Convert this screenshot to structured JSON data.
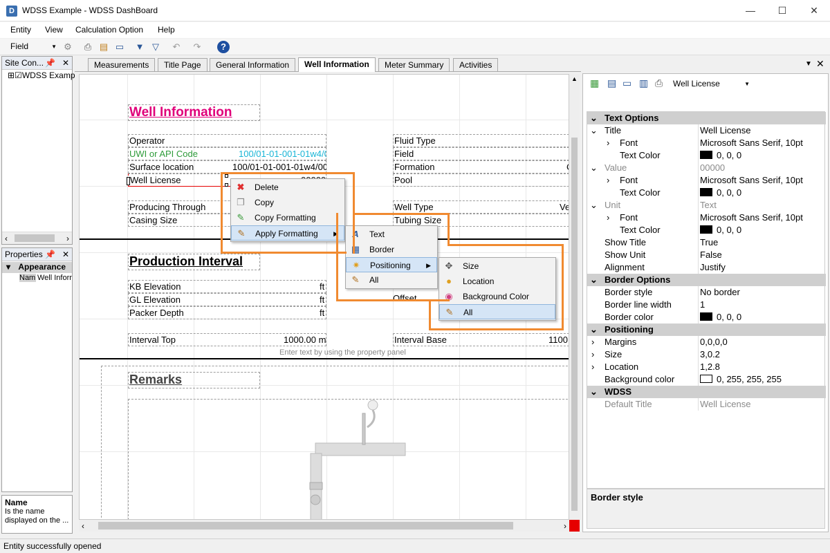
{
  "window": {
    "title": "WDSS Example - WDSS DashBoard",
    "icon_letter": "D"
  },
  "menu": [
    "Entity",
    "View",
    "Calculation Option",
    "Help"
  ],
  "toolbar": {
    "field_combo": "Field"
  },
  "site_panel": {
    "title": "Site Con...",
    "tree_item": "WDSS Examp"
  },
  "props_panel": {
    "title": "Properties",
    "section": "Appearance",
    "row_key": "Nam",
    "row_value": "Well Inform",
    "desc_title": "Name",
    "desc_text": "Is the name displayed on the ..."
  },
  "tabs": [
    "Measurements",
    "Title Page",
    "General Information",
    "Well Information",
    "Meter Summary",
    "Activities"
  ],
  "active_tab": "Well Information",
  "report": {
    "title": "Well Information",
    "left_fields": [
      {
        "label": "Operator",
        "value": ""
      },
      {
        "label": "UWI or API Code",
        "value": "100/01-01-001-01w4/0"
      },
      {
        "label": "Surface location",
        "value": "100/01-01-001-01w4/00"
      },
      {
        "label": "Well License",
        "value": "00000"
      },
      {
        "label": "Producing Through",
        "value": ""
      },
      {
        "label": "Casing Size",
        "value": ""
      }
    ],
    "right_fields": [
      "Fluid Type",
      "Field",
      "Formation",
      "Pool",
      "Well Type",
      "Tubing Size"
    ],
    "right_value_ve": "Ve",
    "right_value_c": "C",
    "production_title": "Production Interval",
    "prod_fields": [
      {
        "label": "KB Elevation",
        "unit": "ft"
      },
      {
        "label": "GL Elevation",
        "unit": "ft"
      },
      {
        "label": "Packer Depth",
        "unit": "ft"
      }
    ],
    "offset_label": "Offset",
    "interval_top": {
      "label": "Interval Top",
      "value": "1000.00 m"
    },
    "interval_base": {
      "label": "Interval Base",
      "value": "1100."
    },
    "hint": "Enter text by using the property panel",
    "remarks_title": "Remarks"
  },
  "context_menu": {
    "items": [
      "Delete",
      "Copy",
      "Copy Formatting",
      "Apply Formatting"
    ],
    "sub1": [
      "Text",
      "Border",
      "Positioning",
      "All"
    ],
    "sub2": [
      "Size",
      "Location",
      "Background Color",
      "All"
    ]
  },
  "right_panel": {
    "combo": "Well License",
    "text_options": "Text Options",
    "rows": [
      {
        "k": "Title",
        "v": "Well License"
      },
      {
        "k": "Font",
        "v": "Microsoft Sans Serif, 10pt"
      },
      {
        "k": "Text Color",
        "v": "0, 0, 0"
      },
      {
        "k": "Value",
        "v": "00000"
      },
      {
        "k": "Font",
        "v": "Microsoft Sans Serif, 10pt"
      },
      {
        "k": "Text Color",
        "v": "0, 0, 0"
      },
      {
        "k": "Unit",
        "v": "Text"
      },
      {
        "k": "Font",
        "v": "Microsoft Sans Serif, 10pt"
      },
      {
        "k": "Text Color",
        "v": "0, 0, 0"
      },
      {
        "k": "Show Title",
        "v": "True"
      },
      {
        "k": "Show Unit",
        "v": "False"
      },
      {
        "k": "Alignment",
        "v": "Justify"
      }
    ],
    "border_options": "Border Options",
    "border_rows": [
      {
        "k": "Border style",
        "v": "No border"
      },
      {
        "k": "Border line width",
        "v": "1"
      },
      {
        "k": "Border color",
        "v": "0, 0, 0"
      }
    ],
    "positioning": "Positioning",
    "pos_rows": [
      {
        "k": "Margins",
        "v": "0,0,0,0"
      },
      {
        "k": "Size",
        "v": "3,0.2"
      },
      {
        "k": "Location",
        "v": "1,2.8"
      },
      {
        "k": "Background color",
        "v": "0, 255, 255, 255"
      }
    ],
    "wdss": "WDSS",
    "wdss_rows": [
      {
        "k": "Default Title",
        "v": "Well License"
      }
    ],
    "desc_title": "Border style"
  },
  "status": "Entity successfully opened",
  "colors": {
    "accent": "#e0007a",
    "green": "#2e9b3a",
    "cyan": "#19b5d6",
    "orange": "#f08a30",
    "red": "#e60000"
  }
}
